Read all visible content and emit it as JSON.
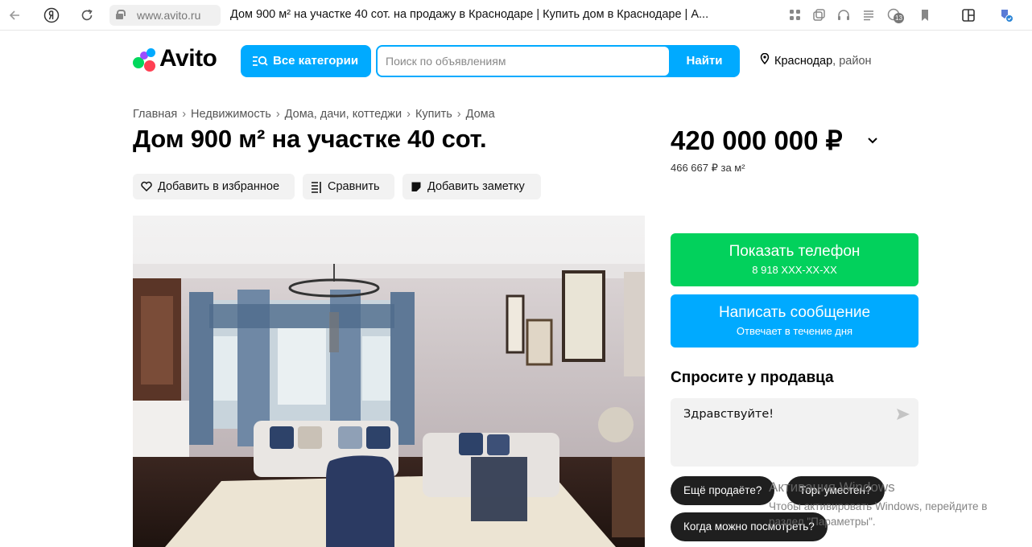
{
  "browser": {
    "url": "www.avito.ru",
    "page_title": "Дом 900 м² на участке 40 сот. на продажу в Краснодаре | Купить дом в Краснодаре | А...",
    "tab_badge": "13"
  },
  "header": {
    "logo_text": "Avito",
    "categories_label": "Все категории",
    "search_placeholder": "Поиск по объявлениям",
    "search_button": "Найти",
    "location_city": "Краснодар",
    "location_rest": ", район"
  },
  "breadcrumbs": [
    "Главная",
    "Недвижимость",
    "Дома, дачи, коттеджи",
    "Купить",
    "Дома"
  ],
  "listing": {
    "title": "Дом 900 м² на участке 40 сот.",
    "price": "420 000 000 ₽",
    "price_per_sqm": "466 667 ₽ за м²"
  },
  "actions": {
    "favorite": "Добавить в избранное",
    "compare": "Сравнить",
    "note": "Добавить заметку"
  },
  "contact": {
    "phone_label": "Показать телефон",
    "phone_masked": "8 918 XXX-XX-XX",
    "message_label": "Написать сообщение",
    "message_sub": "Отвечает в течение дня"
  },
  "ask": {
    "heading": "Спросите у продавца",
    "message_value": "Здравствуйте!",
    "chips": [
      "Ещё продаёте?",
      "Торг уместен?",
      "Когда можно посмотреть?"
    ]
  },
  "watermark": {
    "line1": "Активация Windows",
    "line2": "Чтобы активировать Windows, перейдите в",
    "line3": "раздел \"Параметры\"."
  },
  "colors": {
    "accent_blue": "#00aaff",
    "phone_green": "#02d15c",
    "chip_dark": "#1f1f1f"
  }
}
